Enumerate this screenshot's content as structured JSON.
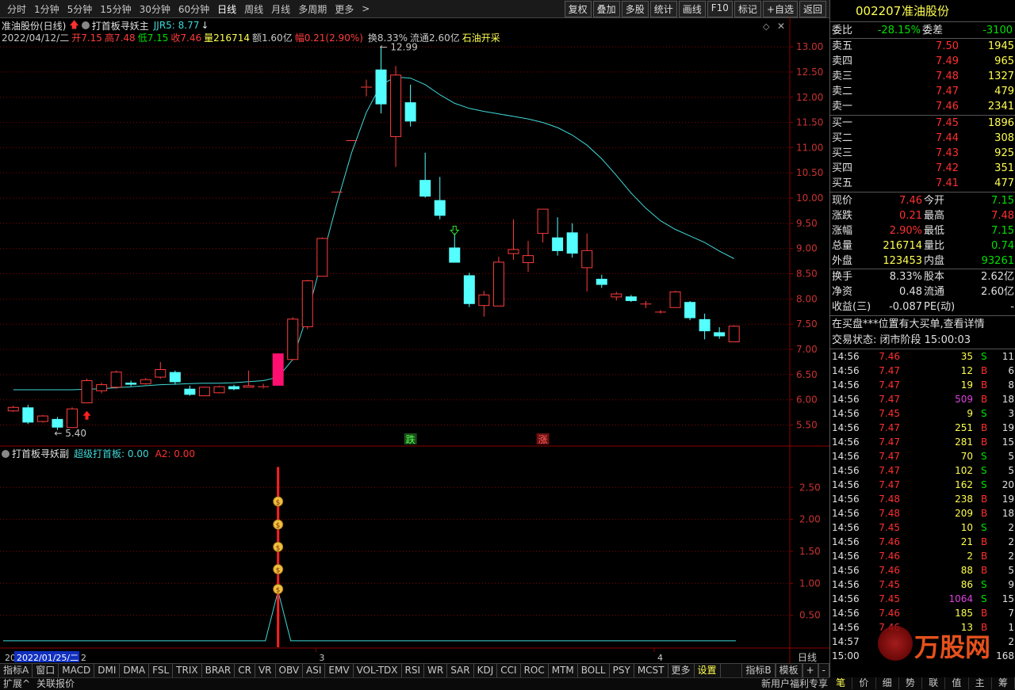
{
  "toolbar": {
    "periods": [
      "分时",
      "1分钟",
      "5分钟",
      "15分钟",
      "30分钟",
      "60分钟",
      "日线",
      "周线",
      "月线",
      "多周期",
      "更多"
    ],
    "active_period": "日线",
    "right_buttons": [
      "复权",
      "叠加",
      "多股",
      "统计",
      "画线",
      "F10",
      "标记",
      "+自选",
      "返回"
    ]
  },
  "header": {
    "title": "准油股份(日线)",
    "indicator_name": "打首板寻妖主",
    "jjr5": "JJR5: 8.77",
    "date": "2022/04/12/二",
    "open": "开7.15",
    "high": "高7.48",
    "low": "低7.15",
    "close": "收7.46",
    "volume": "量216714",
    "amount": "额1.60亿",
    "change": "幅0.21(2.90%)",
    "turnover": "换8.33%",
    "float": "流通2.60亿",
    "sector": "石油开采"
  },
  "sub_header": {
    "name": "打首板寻妖副",
    "label1": "超级打首板: 0.00",
    "label2": "A2: 0.00"
  },
  "annotations": {
    "high_label": "12.99",
    "low_label": "5.40",
    "die": "跌",
    "zhang": "涨"
  },
  "x_axis": {
    "labels": [
      "3",
      "4"
    ],
    "date_box": "2022/01/25/二",
    "left_cut": "20",
    "after_box": "2",
    "period_label": "日线"
  },
  "colors": {
    "up": "#ff3c3c",
    "down": "#54ffff",
    "ma": "#40d8d8",
    "limit": "#ff1070",
    "grid": "#8b0000",
    "signal": "#ff2020"
  },
  "chart_data": {
    "type": "candlestick",
    "y_ticks": [
      5.5,
      6.0,
      6.5,
      7.0,
      7.5,
      8.0,
      8.5,
      9.0,
      9.5,
      10.0,
      10.5,
      11.0,
      11.5,
      12.0,
      12.5,
      13.0
    ],
    "y_range": [
      5.1,
      13.3
    ],
    "candles": [
      {
        "o": 5.78,
        "h": 5.88,
        "l": 5.76,
        "c": 5.85
      },
      {
        "o": 5.85,
        "h": 5.9,
        "l": 5.52,
        "c": 5.55
      },
      {
        "o": 5.57,
        "h": 5.7,
        "l": 5.55,
        "c": 5.68
      },
      {
        "o": 5.62,
        "h": 5.66,
        "l": 5.4,
        "c": 5.45
      },
      {
        "o": 5.45,
        "h": 5.85,
        "l": 5.45,
        "c": 5.82
      },
      {
        "o": 5.94,
        "h": 6.42,
        "l": 5.94,
        "c": 6.38
      },
      {
        "o": 6.18,
        "h": 6.34,
        "l": 6.13,
        "c": 6.3
      },
      {
        "o": 6.25,
        "h": 6.58,
        "l": 6.22,
        "c": 6.55
      },
      {
        "o": 6.34,
        "h": 6.38,
        "l": 6.27,
        "c": 6.3
      },
      {
        "o": 6.32,
        "h": 6.43,
        "l": 6.3,
        "c": 6.4
      },
      {
        "o": 6.45,
        "h": 6.75,
        "l": 6.42,
        "c": 6.6
      },
      {
        "o": 6.55,
        "h": 6.58,
        "l": 6.3,
        "c": 6.35
      },
      {
        "o": 6.22,
        "h": 6.28,
        "l": 6.08,
        "c": 6.1
      },
      {
        "o": 6.08,
        "h": 6.26,
        "l": 6.08,
        "c": 6.25
      },
      {
        "o": 6.14,
        "h": 6.28,
        "l": 6.13,
        "c": 6.26
      },
      {
        "o": 6.27,
        "h": 6.3,
        "l": 6.19,
        "c": 6.21
      },
      {
        "o": 6.25,
        "h": 6.58,
        "l": 6.25,
        "c": 6.28
      },
      {
        "o": 6.24,
        "h": 6.32,
        "l": 6.22,
        "c": 6.26
      },
      {
        "o": 6.28,
        "h": 6.92,
        "l": 6.28,
        "c": 6.92
      },
      {
        "o": 6.8,
        "h": 7.64,
        "l": 6.78,
        "c": 7.6
      },
      {
        "o": 7.45,
        "h": 8.38,
        "l": 7.4,
        "c": 8.36
      },
      {
        "o": 8.45,
        "h": 9.22,
        "l": 8.45,
        "c": 9.2
      },
      {
        "o": 10.12,
        "h": 10.12,
        "l": 10.12,
        "c": 10.12
      },
      {
        "o": 11.14,
        "h": 11.14,
        "l": 11.14,
        "c": 11.14
      },
      {
        "o": 12.18,
        "h": 12.35,
        "l": 12.02,
        "c": 12.2
      },
      {
        "o": 12.55,
        "h": 12.99,
        "l": 11.68,
        "c": 11.86
      },
      {
        "o": 11.22,
        "h": 12.62,
        "l": 10.62,
        "c": 12.44
      },
      {
        "o": 11.9,
        "h": 12.25,
        "l": 11.42,
        "c": 11.52
      },
      {
        "o": 10.36,
        "h": 10.9,
        "l": 10.01,
        "c": 10.03
      },
      {
        "o": 9.96,
        "h": 10.42,
        "l": 9.58,
        "c": 9.65
      },
      {
        "o": 9.02,
        "h": 9.3,
        "l": 8.72,
        "c": 8.72
      },
      {
        "o": 8.47,
        "h": 8.52,
        "l": 7.84,
        "c": 7.9
      },
      {
        "o": 7.87,
        "h": 8.16,
        "l": 7.65,
        "c": 8.08
      },
      {
        "o": 7.86,
        "h": 8.84,
        "l": 7.86,
        "c": 8.73
      },
      {
        "o": 8.9,
        "h": 9.58,
        "l": 8.78,
        "c": 8.98
      },
      {
        "o": 8.72,
        "h": 9.15,
        "l": 8.54,
        "c": 8.86
      },
      {
        "o": 9.3,
        "h": 9.78,
        "l": 9.12,
        "c": 9.78
      },
      {
        "o": 9.22,
        "h": 9.62,
        "l": 8.86,
        "c": 8.95
      },
      {
        "o": 9.32,
        "h": 9.5,
        "l": 8.82,
        "c": 8.9
      },
      {
        "o": 8.62,
        "h": 9.3,
        "l": 8.15,
        "c": 8.96
      },
      {
        "o": 8.4,
        "h": 8.48,
        "l": 8.22,
        "c": 8.28
      },
      {
        "o": 8.04,
        "h": 8.14,
        "l": 7.97,
        "c": 8.1
      },
      {
        "o": 8.05,
        "h": 8.08,
        "l": 7.94,
        "c": 7.96
      },
      {
        "o": 7.9,
        "h": 7.96,
        "l": 7.82,
        "c": 7.9
      },
      {
        "o": 7.73,
        "h": 7.78,
        "l": 7.71,
        "c": 7.74
      },
      {
        "o": 7.83,
        "h": 8.16,
        "l": 7.83,
        "c": 8.14
      },
      {
        "o": 7.94,
        "h": 7.96,
        "l": 7.58,
        "c": 7.62
      },
      {
        "o": 7.6,
        "h": 7.71,
        "l": 7.2,
        "c": 7.36
      },
      {
        "o": 7.34,
        "h": 7.44,
        "l": 7.21,
        "c": 7.26
      },
      {
        "o": 7.15,
        "h": 7.48,
        "l": 7.15,
        "c": 7.46
      }
    ],
    "ma": [
      6.2,
      6.2,
      6.2,
      6.2,
      6.2,
      6.21,
      6.22,
      6.24,
      6.26,
      6.28,
      6.3,
      6.31,
      6.32,
      6.33,
      6.33,
      6.34,
      6.36,
      6.38,
      6.45,
      6.8,
      7.7,
      8.8,
      9.9,
      10.9,
      11.7,
      12.25,
      12.4,
      12.38,
      12.25,
      12.05,
      11.88,
      11.78,
      11.72,
      11.67,
      11.62,
      11.57,
      11.5,
      11.4,
      11.25,
      11.05,
      10.78,
      10.45,
      10.1,
      9.8,
      9.55,
      9.38,
      9.25,
      9.12,
      8.95,
      8.8
    ],
    "limit_up_index": 18,
    "sub_y_ticks": [
      0.5,
      1.0,
      1.5,
      2.0,
      2.5
    ],
    "sub_y_range": [
      0,
      2.9
    ],
    "signal_index": 18
  },
  "panel": {
    "code": "002207",
    "name": "准油股份",
    "weibi": {
      "label": "委比",
      "value": "-28.15%",
      "label2": "委差",
      "value2": "-3100"
    },
    "asks": [
      {
        "label": "卖五",
        "price": "7.50",
        "vol": "1945"
      },
      {
        "label": "卖四",
        "price": "7.49",
        "vol": "965"
      },
      {
        "label": "卖三",
        "price": "7.48",
        "vol": "1327"
      },
      {
        "label": "卖二",
        "price": "7.47",
        "vol": "479"
      },
      {
        "label": "卖一",
        "price": "7.46",
        "vol": "2341"
      }
    ],
    "bids": [
      {
        "label": "买一",
        "price": "7.45",
        "vol": "1896"
      },
      {
        "label": "买二",
        "price": "7.44",
        "vol": "308"
      },
      {
        "label": "买三",
        "price": "7.43",
        "vol": "925"
      },
      {
        "label": "买四",
        "price": "7.42",
        "vol": "351"
      },
      {
        "label": "买五",
        "price": "7.41",
        "vol": "477"
      }
    ],
    "quote": [
      {
        "l1": "现价",
        "v1": "7.46",
        "l2": "今开",
        "v2": "7.15"
      },
      {
        "l1": "涨跌",
        "v1": "0.21",
        "l2": "最高",
        "v2": "7.48"
      },
      {
        "l1": "涨幅",
        "v1": "2.90%",
        "l2": "最低",
        "v2": "7.15"
      },
      {
        "l1": "总量",
        "v1": "216714",
        "l2": "量比",
        "v2": "0.74"
      },
      {
        "l1": "外盘",
        "v1": "123453",
        "l2": "内盘",
        "v2": "93261"
      }
    ],
    "finance": [
      {
        "l1": "换手",
        "v1": "8.33%",
        "l2": "股本",
        "v2": "2.62亿"
      },
      {
        "l1": "净资",
        "v1": "0.48",
        "l2": "流通",
        "v2": "2.60亿"
      },
      {
        "l1": "收益(三)",
        "v1": "-0.087",
        "l2": "PE(动)",
        "v2": "-"
      }
    ],
    "notice": "在买盘***位置有大买单,查看详情",
    "trade_status": "交易状态: 闭市阶段 15:00:03",
    "ticks": [
      {
        "t": "14:56",
        "p": "7.46",
        "v": "35",
        "s": "S",
        "n": "11"
      },
      {
        "t": "14:56",
        "p": "7.47",
        "v": "12",
        "s": "B",
        "n": "6"
      },
      {
        "t": "14:56",
        "p": "7.47",
        "v": "19",
        "s": "B",
        "n": "8"
      },
      {
        "t": "14:56",
        "p": "7.47",
        "v": "509",
        "s": "B",
        "n": "18"
      },
      {
        "t": "14:56",
        "p": "7.45",
        "v": "9",
        "s": "S",
        "n": "3"
      },
      {
        "t": "14:56",
        "p": "7.47",
        "v": "251",
        "s": "B",
        "n": "19"
      },
      {
        "t": "14:56",
        "p": "7.47",
        "v": "281",
        "s": "B",
        "n": "15"
      },
      {
        "t": "14:56",
        "p": "7.47",
        "v": "70",
        "s": "S",
        "n": "5"
      },
      {
        "t": "14:56",
        "p": "7.47",
        "v": "102",
        "s": "S",
        "n": "5"
      },
      {
        "t": "14:56",
        "p": "7.47",
        "v": "162",
        "s": "S",
        "n": "20"
      },
      {
        "t": "14:56",
        "p": "7.48",
        "v": "238",
        "s": "B",
        "n": "19"
      },
      {
        "t": "14:56",
        "p": "7.48",
        "v": "209",
        "s": "B",
        "n": "18"
      },
      {
        "t": "14:56",
        "p": "7.45",
        "v": "10",
        "s": "S",
        "n": "2"
      },
      {
        "t": "14:56",
        "p": "7.46",
        "v": "21",
        "s": "B",
        "n": "2"
      },
      {
        "t": "14:56",
        "p": "7.46",
        "v": "2",
        "s": "B",
        "n": "2"
      },
      {
        "t": "14:56",
        "p": "7.46",
        "v": "88",
        "s": "B",
        "n": "5"
      },
      {
        "t": "14:56",
        "p": "7.45",
        "v": "86",
        "s": "S",
        "n": "9"
      },
      {
        "t": "14:56",
        "p": "7.45",
        "v": "1064",
        "s": "S",
        "n": "15"
      },
      {
        "t": "14:56",
        "p": "7.46",
        "v": "185",
        "s": "B",
        "n": "7"
      },
      {
        "t": "14:56",
        "p": "7.46",
        "v": "13",
        "s": "B",
        "n": "1"
      },
      {
        "t": "14:57",
        "p": "",
        "v": "",
        "s": "",
        "n": "2"
      },
      {
        "t": "15:00",
        "p": "",
        "v": "",
        "s": "",
        "n": "168"
      }
    ],
    "bottom_tabs": [
      "笔",
      "价",
      "细",
      "势",
      "联",
      "值",
      "主",
      "筹"
    ],
    "watermark": "万股网"
  },
  "bottom_tabs": [
    "指标A",
    "窗口",
    "MACD",
    "DMI",
    "DMA",
    "FSL",
    "TRIX",
    "BRAR",
    "CR",
    "VR",
    "OBV",
    "ASI",
    "EMV",
    "VOL-TDX",
    "RSI",
    "WR",
    "SAR",
    "KDJ",
    "CCI",
    "ROC",
    "MTM",
    "BOLL",
    "PSY",
    "MCST",
    "更多",
    "设置"
  ],
  "bottom_right": [
    "指标B",
    "模板",
    "+",
    "-"
  ],
  "status_left": [
    "扩展^",
    "关联报价"
  ],
  "status_right": "新用户福利专享"
}
